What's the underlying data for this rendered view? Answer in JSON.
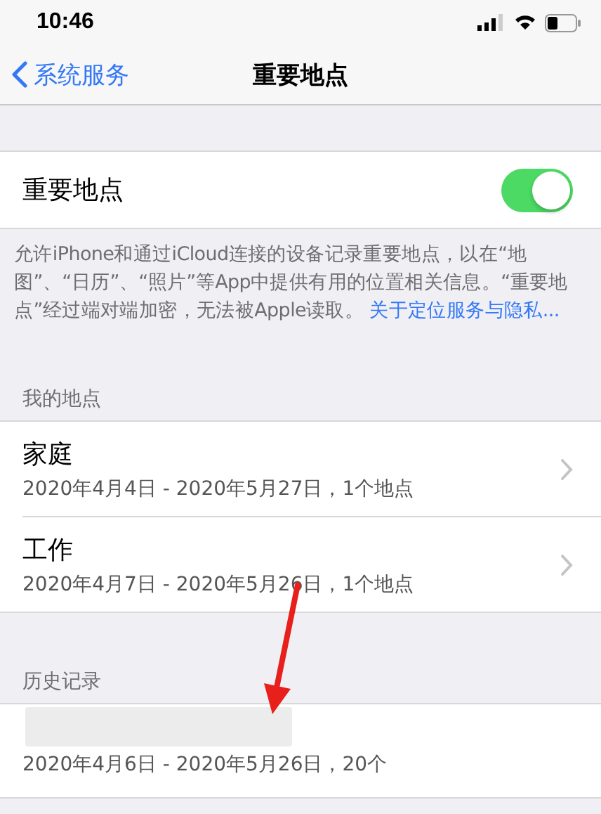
{
  "status_bar": {
    "time": "10:46"
  },
  "nav": {
    "back": "系统服务",
    "title": "重要地点"
  },
  "toggle": {
    "label": "重要地点",
    "on": true
  },
  "description": {
    "text": "允许iPhone和通过iCloud连接的设备记录重要地点，以在“地图”、“日历”、“照片”等App中提供有用的位置相关信息。“重要地点”经过端对端加密，无法被Apple读取。",
    "link": "关于定位服务与隐私..."
  },
  "my_places": {
    "header": "我的地点",
    "items": [
      {
        "title": "家庭",
        "subtitle": "2020年4月4日 - 2020年5月27日，1个地点"
      },
      {
        "title": "工作",
        "subtitle": "2020年4月7日 - 2020年5月26日，1个地点"
      }
    ]
  },
  "history": {
    "header": "历史记录",
    "items": [
      {
        "subtitle": "2020年4月6日 - 2020年5月26日，20个"
      }
    ]
  }
}
